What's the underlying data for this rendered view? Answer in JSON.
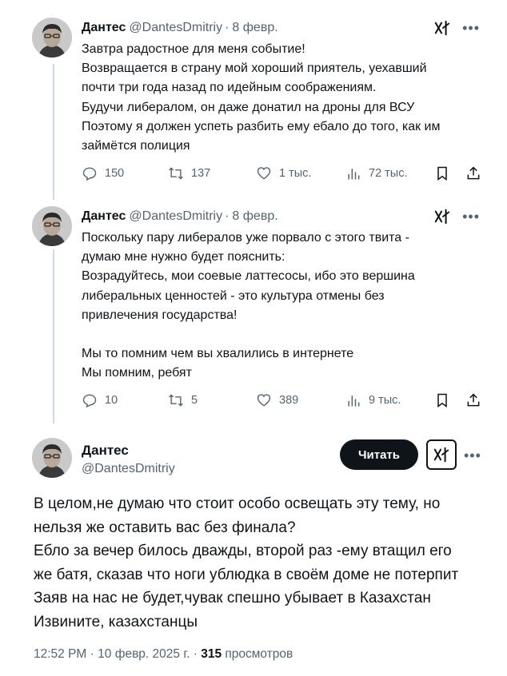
{
  "tweet1": {
    "name": "Дантес",
    "handle": "@DantesDmitriy",
    "separator": "·",
    "date": "8 февр.",
    "lines": [
      "Завтра радостное для меня событие!",
      "Возвращается в страну мой хороший приятель, уехавший",
      "почти три года назад по идейным соображениям.",
      "Будучи либералом, он даже донатил на дроны для ВСУ",
      "Поэтому я должен успеть разбить ему ебало до того, как им",
      "займётся полиция"
    ],
    "replies": "150",
    "reposts": "137",
    "likes": "1 тыс.",
    "views": "72 тыс."
  },
  "tweet2": {
    "name": "Дантес",
    "handle": "@DantesDmitriy",
    "separator": "·",
    "date": "8 февр.",
    "lines": [
      "Поскольку пару либералов уже порвало с этого твита -",
      "думаю мне нужно будет пояснить:",
      "Возрадуйтесь, мои соевые латтесосы, ибо это вершина",
      "либеральных ценностей - это культура отмены без",
      "привлечения государства!",
      "",
      "Мы то помним чем вы хвалились в интернете",
      "Мы помним, ребят"
    ],
    "replies": "10",
    "reposts": "5",
    "likes": "389",
    "views": "9 тыс."
  },
  "tweet3": {
    "name": "Дантес",
    "handle": "@DantesDmitriy",
    "read_button": "Читать",
    "lines": [
      "В целом,не думаю что стоит особо освещать эту тему, но",
      "нельзя же оставить вас без финала?",
      "Ебло за вечер билось дважды, второй раз -ему втащил его",
      "же батя, сказав что ноги ублюдка в своём доме не потерпит",
      "Заяв на нас не будет,чувак спешно убывает в Казахстан",
      "Извините, казахстанцы"
    ],
    "time": "12:52 PM",
    "separator": "·",
    "full_date": "10 февр. 2025 г.",
    "views_count": "315",
    "views_label": "просмотров"
  },
  "colors": {
    "text": "#0f1419",
    "secondary": "#536471",
    "thread_line": "#cfd9de",
    "button_bg": "#0f1419"
  },
  "icons": [
    "reply-icon",
    "repost-icon",
    "like-icon",
    "views-icon",
    "bookmark-icon",
    "share-icon",
    "grok-icon",
    "more-icon"
  ]
}
